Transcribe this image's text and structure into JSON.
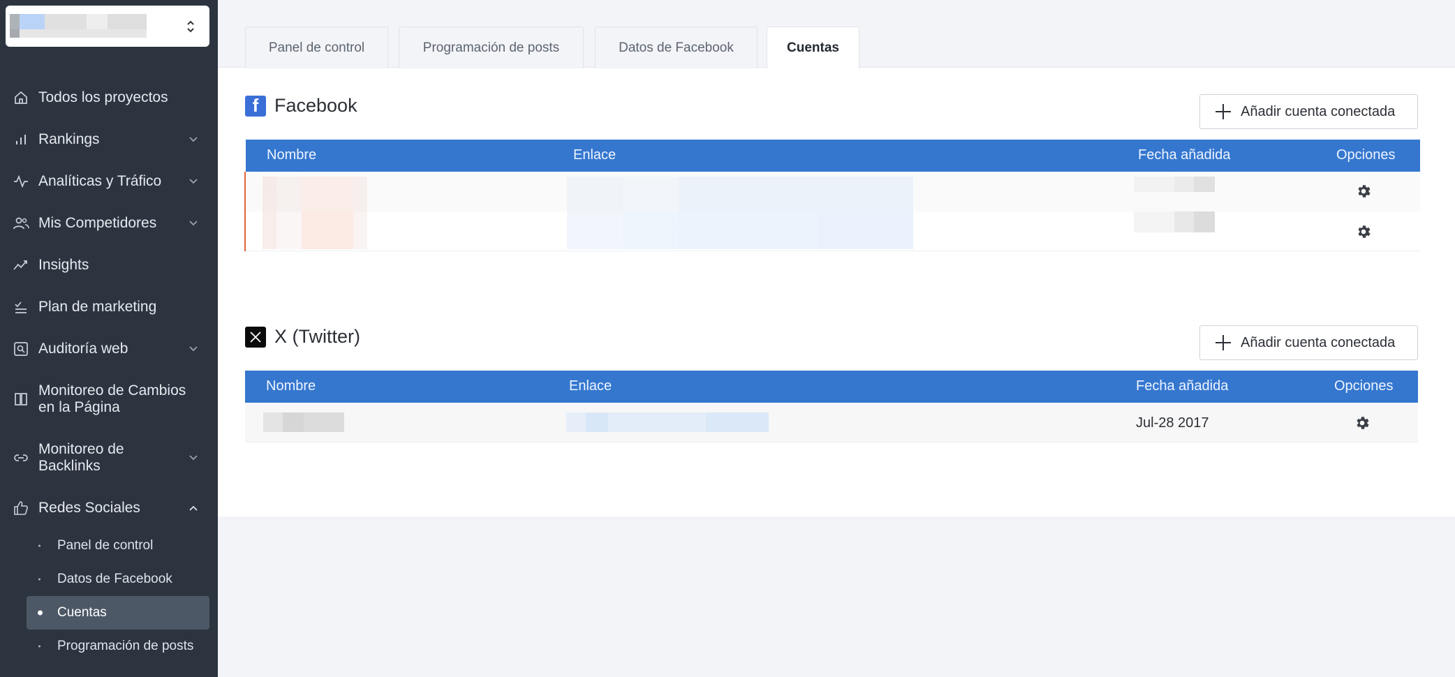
{
  "sidebar": {
    "nav": [
      {
        "label": "Todos los proyectos",
        "icon": "home-icon"
      },
      {
        "label": "Rankings",
        "icon": "bar-chart-icon"
      },
      {
        "label": "Analíticas y Tráfico",
        "icon": "activity-icon"
      },
      {
        "label": "Mis Competidores",
        "icon": "users-icon"
      },
      {
        "label": "Insights",
        "icon": "trend-icon"
      },
      {
        "label": "Plan de marketing",
        "icon": "checklist-icon"
      },
      {
        "label": "Auditoría web",
        "icon": "audit-icon"
      },
      {
        "label_1": "Monitoreo de Cambios",
        "label_2": "en la Página",
        "icon": "book-icon"
      },
      {
        "label_1": "Monitoreo de",
        "label_2": "Backlinks",
        "icon": "link-icon"
      },
      {
        "label": "Redes Sociales",
        "icon": "thumbs-up-icon"
      }
    ],
    "sub": [
      {
        "label": "Panel de control"
      },
      {
        "label": "Datos de Facebook"
      },
      {
        "label": "Cuentas"
      },
      {
        "label": "Programación de posts"
      }
    ]
  },
  "tabs": [
    {
      "label": "Panel de control"
    },
    {
      "label": "Programación de posts"
    },
    {
      "label": "Datos de Facebook"
    },
    {
      "label": "Cuentas"
    }
  ],
  "facebook": {
    "title": "Facebook",
    "add_label": "Añadir cuenta conectada",
    "columns": {
      "name": "Nombre",
      "link": "Enlace",
      "date": "Fecha añadida",
      "options": "Opciones"
    }
  },
  "twitter": {
    "title": "X (Twitter)",
    "add_label": "Añadir cuenta conectada",
    "columns": {
      "name": "Nombre",
      "link": "Enlace",
      "date": "Fecha añadida",
      "options": "Opciones"
    },
    "rows": [
      {
        "date": "Jul-28 2017"
      }
    ]
  },
  "colors": {
    "accent": "#3577cf",
    "sidebar": "#2c3440",
    "fb_blue": "#3a6fd8",
    "error": "#e0633f"
  }
}
